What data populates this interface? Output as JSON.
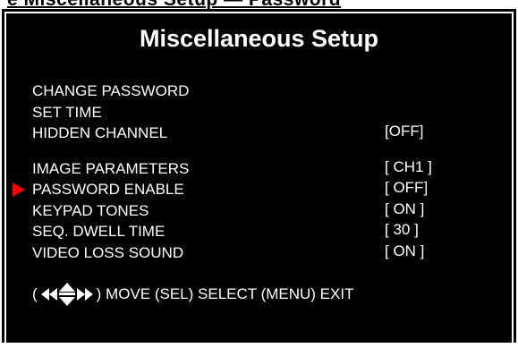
{
  "header_cut_text": "e  Miscellaneous Setup — Password",
  "title": "Miscellaneous Setup",
  "menu": {
    "items": [
      {
        "label": "CHANGE PASSWORD",
        "value": ""
      },
      {
        "label": "SET TIME",
        "value": ""
      },
      {
        "label": "HIDDEN CHANNEL",
        "value": "[OFF]"
      },
      {
        "label": "IMAGE PARAMETERS",
        "value": "[ CH1 ]"
      },
      {
        "label": "PASSWORD ENABLE",
        "value": "[ OFF]"
      },
      {
        "label": "KEYPAD TONES",
        "value": "[ ON ]"
      },
      {
        "label": "SEQ. DWELL TIME",
        "value": "[ 30 ]"
      },
      {
        "label": "VIDEO LOSS SOUND",
        "value": "[ ON ]"
      }
    ],
    "selected_item": "PASSWORD ENABLE"
  },
  "hint": {
    "open": "(",
    "move": ") MOVE (SEL) SELECT (MENU) EXIT"
  },
  "colors": {
    "background": "#000000",
    "text": "#ffffff",
    "cursor": "#ff0000"
  },
  "icons": [
    "left-arrows-icon",
    "up-down-arrows-icon",
    "right-arrows-icon",
    "selection-cursor-icon"
  ]
}
